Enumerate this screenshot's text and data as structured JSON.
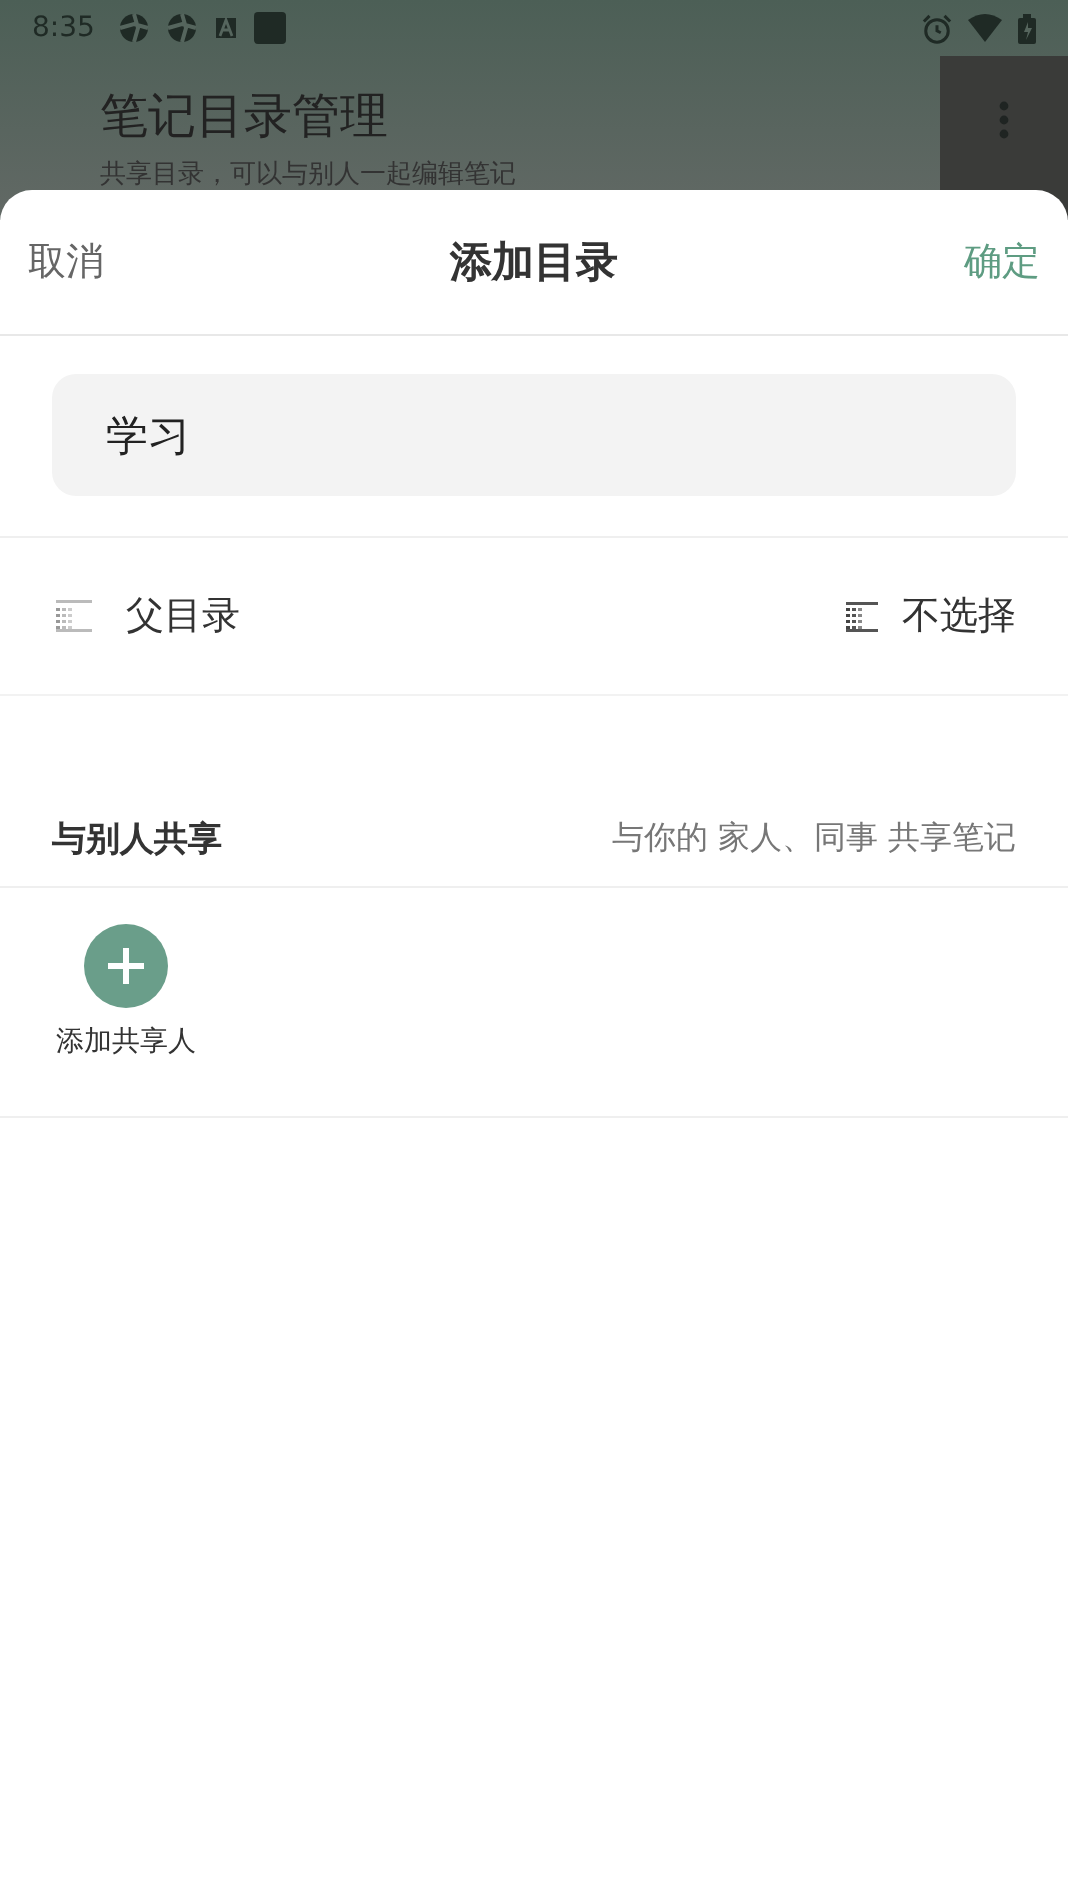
{
  "status_bar": {
    "time": "8:35"
  },
  "background": {
    "title": "笔记目录管理",
    "subtitle": "共享目录，可以与别人一起编辑笔记"
  },
  "sheet": {
    "cancel": "取消",
    "title": "添加目录",
    "confirm": "确定",
    "name_field": {
      "value": "学习"
    },
    "parent": {
      "label": "父目录",
      "value": "不选择"
    },
    "share": {
      "title": "与别人共享",
      "hint": "与你的 家人、同事 共享笔记",
      "add_label": "添加共享人"
    }
  }
}
